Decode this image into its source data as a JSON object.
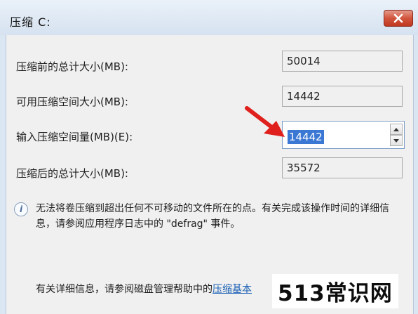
{
  "window": {
    "title": "压缩 C:"
  },
  "fields": [
    {
      "label": "压缩前的总计大小(MB):",
      "value": "50014"
    },
    {
      "label": "可用压缩空间大小(MB):",
      "value": "14442"
    },
    {
      "label": "输入压缩空间量(MB)(E):",
      "value": "14442"
    },
    {
      "label": "压缩后的总计大小(MB):",
      "value": "35572"
    }
  ],
  "info": {
    "icon": "info-icon",
    "text": "无法将卷压缩到超出任何不可移动的文件所在的点。有关完成该操作时间的详细信息，请参阅应用程序日志中的 \"defrag\" 事件。"
  },
  "help": {
    "prefix": "有关详细信息，请参阅磁盘管理帮助中的",
    "link": "压缩基本"
  },
  "watermark": "513常识网",
  "colors": {
    "annotation_arrow": "#e0201c",
    "selection": "#3a78d4",
    "close_button": "#c8412a"
  }
}
